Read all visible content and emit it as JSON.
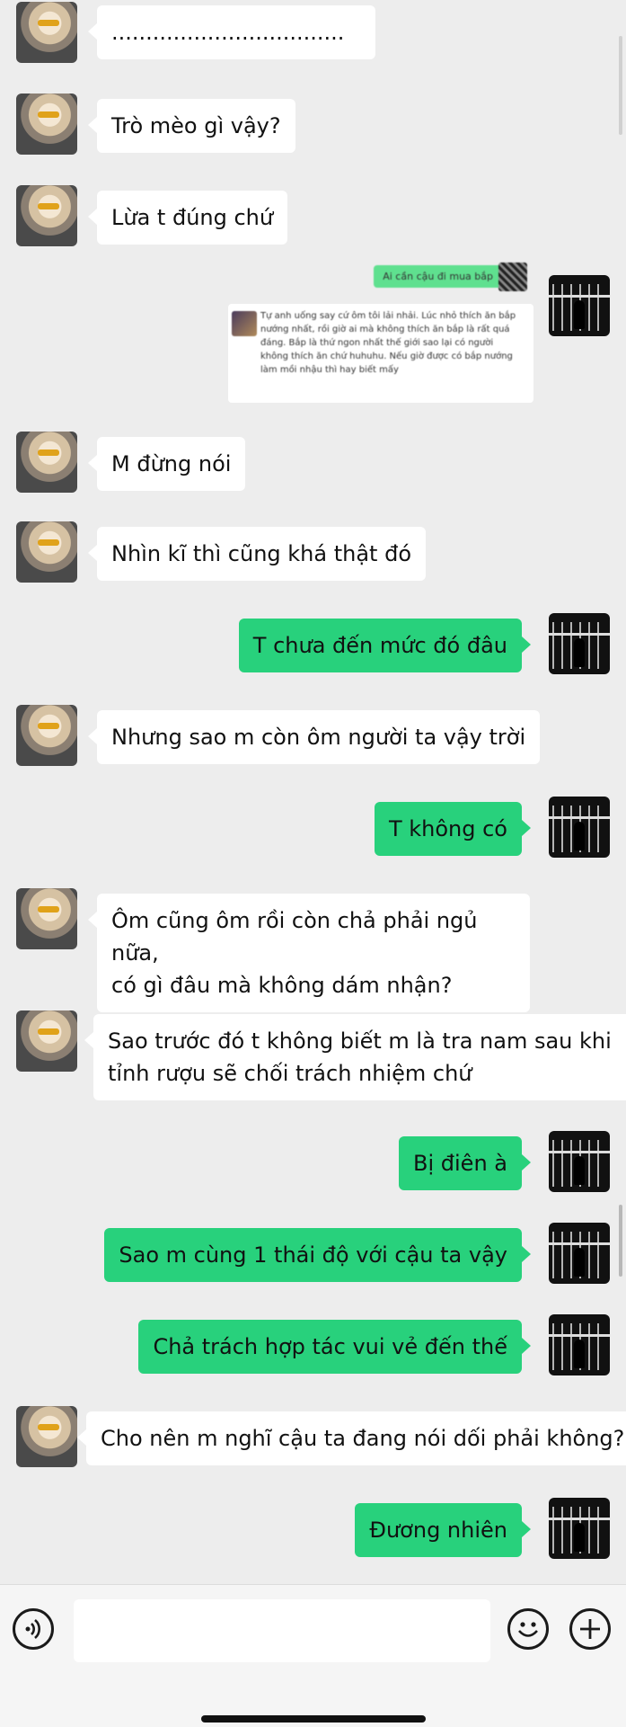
{
  "messages": [
    {
      "side": "left",
      "text": ".................................."
    },
    {
      "side": "left",
      "text": "Trò mèo gì vậy?"
    },
    {
      "side": "left",
      "text": "Lừa t đúng chứ"
    },
    {
      "side": "quote",
      "top_text": "Ai cần cậu đi mua bắp",
      "card_text": "Tự anh uống say cứ ôm tôi lải nhải. Lúc nhỏ thích ăn bắp nướng nhất, rồi giờ ai mà không thích ăn bắp là rất quá đáng. Bắp là thứ ngon nhất thế giới sao lại có người không thích ăn chứ huhuhu. Nếu giờ được có bắp nướng làm mồi nhậu thì hay biết mấy"
    },
    {
      "side": "left",
      "text": "M đừng nói"
    },
    {
      "side": "left",
      "text": "Nhìn kĩ thì cũng khá thật đó"
    },
    {
      "side": "right",
      "text": "T chưa đến mức đó đâu"
    },
    {
      "side": "left",
      "text": "Nhưng sao m còn ôm người ta vậy trời"
    },
    {
      "side": "right",
      "text": "T không có"
    },
    {
      "side": "left",
      "line1": "Ôm cũng ôm rồi còn chả phải ngủ nữa,",
      "line2": "có gì đâu mà không dám nhận?"
    },
    {
      "side": "left",
      "line1": "Sao trước đó t không biết m là tra nam sau khi",
      "line2": "tỉnh rượu sẽ chối trách nhiệm chứ"
    },
    {
      "side": "right",
      "text": "Bị điên à"
    },
    {
      "side": "right",
      "text": "Sao m cùng 1 thái độ với cậu ta vậy"
    },
    {
      "side": "right",
      "text": "Chả trách hợp tác vui vẻ đến thế"
    },
    {
      "side": "left",
      "text": "Cho nên m nghĩ cậu ta đang nói dối phải không?"
    },
    {
      "side": "right",
      "text": "Đương nhiên"
    }
  ],
  "colors": {
    "bubble_right": "#28d17c",
    "bubble_left": "#ffffff",
    "background": "#ededed"
  },
  "icons": {
    "voice": "voice-icon",
    "emoji": "emoji-icon",
    "plus": "plus-icon"
  }
}
